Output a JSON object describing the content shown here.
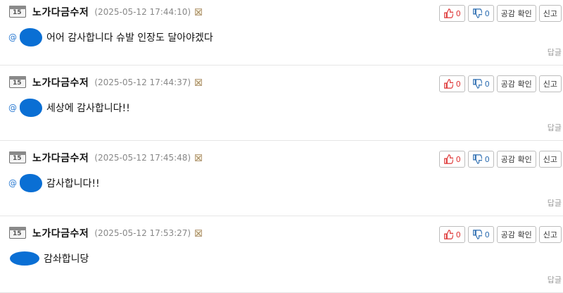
{
  "comments": [
    {
      "author": "노가다금수저",
      "date": "(2025-05-12 17:44:10)",
      "level": "15",
      "mention_prefix": "@",
      "text": "어어 감사합니다 슈발 인장도 달아야겠다",
      "like_count": "0",
      "dislike_count": "0",
      "empathy_label": "공감 확인",
      "report_label": "신고",
      "reply_label": "답글"
    },
    {
      "author": "노가다금수저",
      "date": "(2025-05-12 17:44:37)",
      "level": "15",
      "mention_prefix": "@",
      "text": "세상에 감사합니다!!",
      "like_count": "0",
      "dislike_count": "0",
      "empathy_label": "공감 확인",
      "report_label": "신고",
      "reply_label": "답글"
    },
    {
      "author": "노가다금수저",
      "date": "(2025-05-12 17:45:48)",
      "level": "15",
      "mention_prefix": "@",
      "text": "감사합니다!!",
      "like_count": "0",
      "dislike_count": "0",
      "empathy_label": "공감 확인",
      "report_label": "신고",
      "reply_label": "답글"
    },
    {
      "author": "노가다금수저",
      "date": "(2025-05-12 17:53:27)",
      "level": "15",
      "mention_prefix": "",
      "text": "감솨합니당",
      "like_count": "0",
      "dislike_count": "0",
      "empathy_label": "공감 확인",
      "report_label": "신고",
      "reply_label": "답글"
    }
  ],
  "colors": {
    "like": "#dd3333",
    "dislike": "#2b6cb0",
    "redaction": "#0a6fd4",
    "mention": "#2a7ad2"
  }
}
